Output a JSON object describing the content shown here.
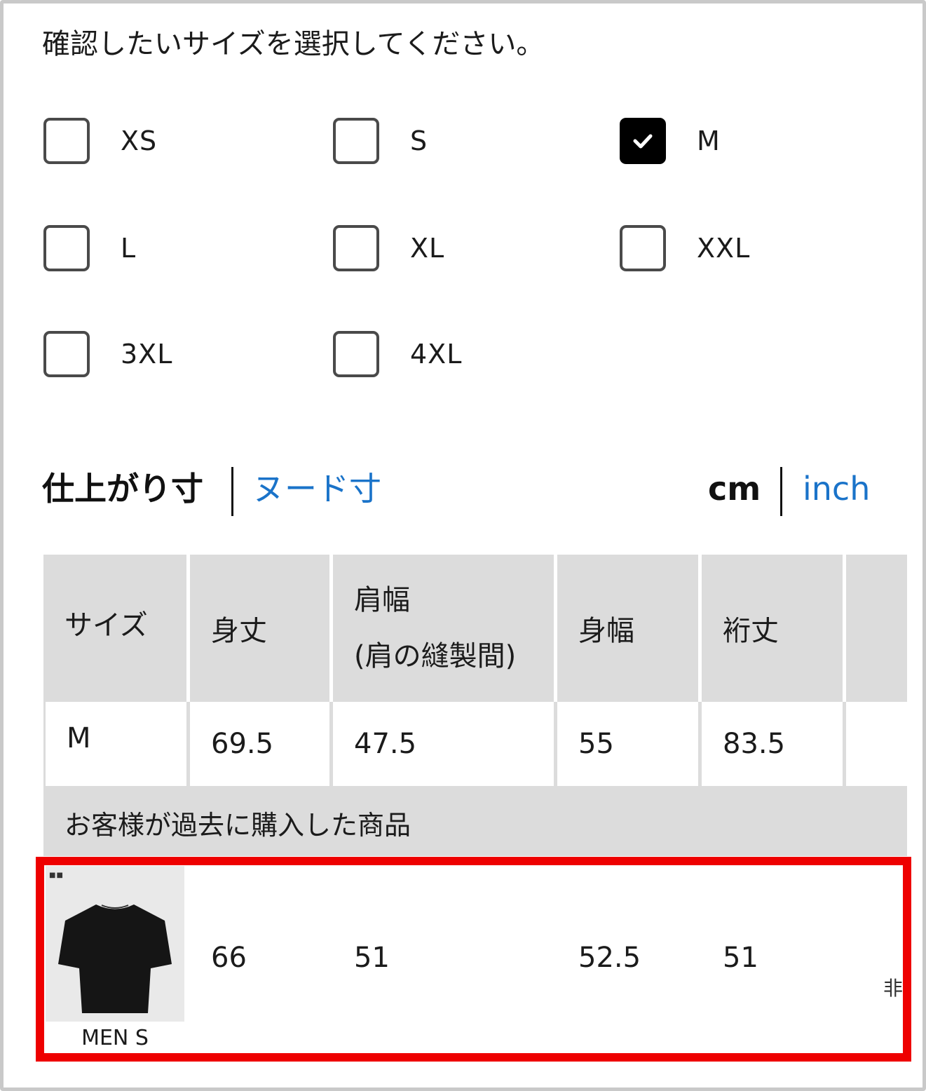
{
  "prompt": "確認したいサイズを選択してください。",
  "sizes": [
    {
      "label": "XS",
      "checked": false
    },
    {
      "label": "S",
      "checked": false
    },
    {
      "label": "M",
      "checked": true
    },
    {
      "label": "L",
      "checked": false
    },
    {
      "label": "XL",
      "checked": false
    },
    {
      "label": "XXL",
      "checked": false
    },
    {
      "label": "3XL",
      "checked": false
    },
    {
      "label": "4XL",
      "checked": false
    }
  ],
  "measure_tabs": {
    "finished": "仕上がり寸",
    "body": "ヌード寸",
    "active": "finished"
  },
  "unit_tabs": {
    "cm": "cm",
    "inch": "inch",
    "active": "cm"
  },
  "table": {
    "headers": [
      "サイズ",
      "身丈",
      "肩幅",
      "(肩の縫製間)",
      "身幅",
      "裄丈"
    ],
    "selected_row": {
      "size": "M",
      "values": [
        "69.5",
        "47.5",
        "55",
        "83.5"
      ]
    },
    "past_purchase_title": "お客様が過去に購入した商品",
    "past_item": {
      "label": "MEN S",
      "values": [
        "66",
        "51",
        "52.5",
        "51"
      ],
      "clipped_text": "非"
    }
  },
  "colors": {
    "link": "#1a73c9",
    "header_bg": "#dcdcdc",
    "highlight": "#ee0000",
    "checkbox_checked": "#000000"
  }
}
